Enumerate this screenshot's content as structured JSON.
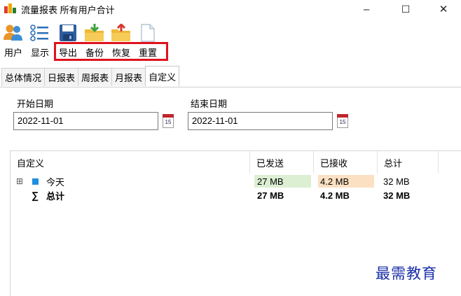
{
  "window": {
    "title": "流量报表 所有用户合计",
    "controls": {
      "minimize": "–",
      "maximize": "☐",
      "close": "✕"
    }
  },
  "toolbar": {
    "buttons": [
      {
        "label": "用户",
        "icon": "users-icon"
      },
      {
        "label": "显示",
        "icon": "list-icon"
      },
      {
        "label": "导出",
        "icon": "save-icon"
      },
      {
        "label": "备份",
        "icon": "folder-down-icon"
      },
      {
        "label": "恢复",
        "icon": "folder-up-icon"
      },
      {
        "label": "重置",
        "icon": "blank-document-icon"
      }
    ],
    "highlight_color": "#e0121d"
  },
  "tabs": [
    {
      "label": "总体情况",
      "active": false
    },
    {
      "label": "日报表",
      "active": false
    },
    {
      "label": "周报表",
      "active": false
    },
    {
      "label": "月报表",
      "active": false
    },
    {
      "label": "自定义",
      "active": true
    }
  ],
  "date_range": {
    "start_label": "开始日期",
    "start_value": "2022-11-01",
    "end_label": "结束日期",
    "end_value": "2022-11-01",
    "calendar_day": "15"
  },
  "table": {
    "columns": [
      "自定义",
      "已发送",
      "已接收",
      "总计"
    ],
    "rows": [
      {
        "expander": "⊞",
        "icon": "blue-square-icon",
        "name": "今天",
        "sent": "27 MB",
        "received": "4.2 MB",
        "total": "32 MB"
      },
      {
        "icon": "sigma-icon",
        "icon_glyph": "∑",
        "name": "总计",
        "sent": "27 MB",
        "received": "4.2 MB",
        "total": "32 MB"
      }
    ],
    "sent_highlight": "#dcefd3",
    "received_highlight": "#fbe0c2"
  },
  "watermark": "最需教育"
}
